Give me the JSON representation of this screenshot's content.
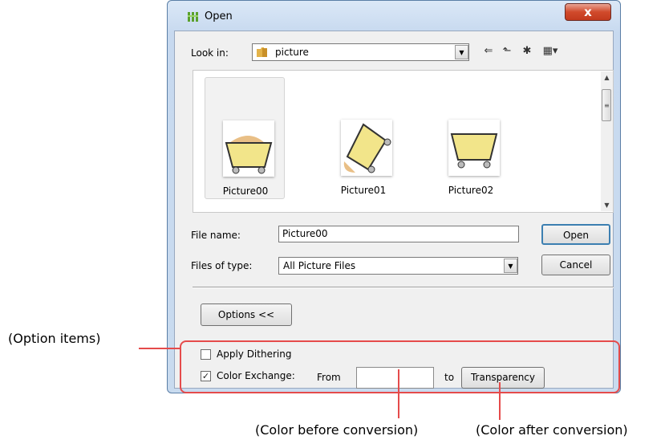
{
  "dialog": {
    "title": "Open",
    "close_label": "x",
    "look_in": {
      "label": "Look in:",
      "value": "picture"
    },
    "files": [
      {
        "name": "Picture00",
        "selected": true
      },
      {
        "name": "Picture01",
        "selected": false
      },
      {
        "name": "Picture02",
        "selected": false
      }
    ],
    "file_name": {
      "label": "File name:",
      "value": "Picture00"
    },
    "file_type": {
      "label": "Files of type:",
      "value": "All Picture Files"
    },
    "buttons": {
      "open": "Open",
      "cancel": "Cancel",
      "options": "Options <<"
    },
    "options": {
      "apply_dithering": {
        "label": "Apply Dithering",
        "checked": false
      },
      "color_exchange": {
        "label": "Color Exchange:",
        "checked": true
      },
      "from_label": "From",
      "to_label": "to",
      "to_button": "Transparency"
    }
  },
  "annotations": {
    "option_items": "(Option items)",
    "color_before": "(Color before conversion)",
    "color_after": "(Color after conversion)"
  },
  "colors": {
    "highlight": "#e54b4b",
    "thumbnail_fill": "#f2e58a",
    "thumbnail_shadow": "#e9bf86"
  }
}
